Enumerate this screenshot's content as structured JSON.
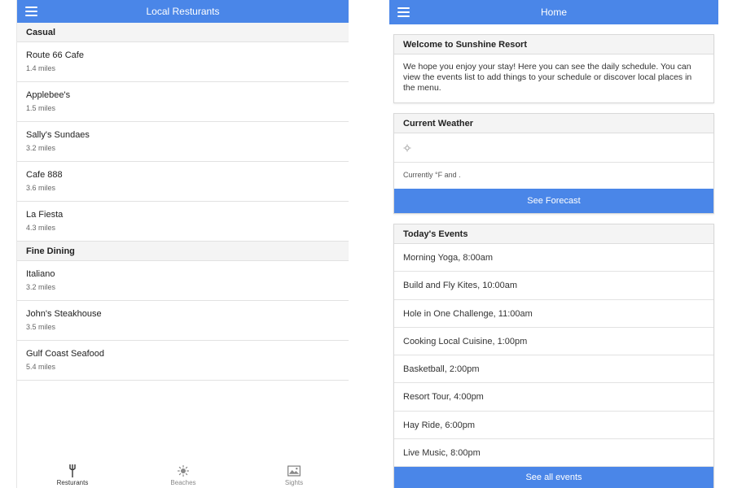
{
  "restaurants_screen": {
    "title": "Local Resturants",
    "sections": [
      {
        "label": "Casual",
        "items": [
          {
            "name": "Route 66 Cafe",
            "distance": "1.4 miles"
          },
          {
            "name": "Applebee's",
            "distance": "1.5 miles"
          },
          {
            "name": "Sally's Sundaes",
            "distance": "3.2 miles"
          },
          {
            "name": "Cafe 888",
            "distance": "3.6 miles"
          },
          {
            "name": "La Fiesta",
            "distance": "4.3 miles"
          }
        ]
      },
      {
        "label": "Fine Dining",
        "items": [
          {
            "name": "Italiano",
            "distance": "3.2 miles"
          },
          {
            "name": "John's Steakhouse",
            "distance": "3.5 miles"
          },
          {
            "name": "Gulf Coast Seafood",
            "distance": "5.4 miles"
          }
        ]
      }
    ],
    "tabs": [
      {
        "label": "Resturants",
        "icon": "fork-icon",
        "active": true
      },
      {
        "label": "Beaches",
        "icon": "sun-icon",
        "active": false
      },
      {
        "label": "Sights",
        "icon": "image-icon",
        "active": false
      }
    ]
  },
  "home_screen": {
    "title": "Home",
    "welcome": {
      "heading": "Welcome to Sunshine Resort",
      "body": "We hope you enjoy your stay! Here you can see the daily schedule. You can view the events list to add things to your schedule or discover local places in the menu."
    },
    "weather": {
      "heading": "Current Weather",
      "icon": "weather-placeholder-icon",
      "text": "Currently °F and .",
      "button_label": "See Forecast"
    },
    "events": {
      "heading": "Today's Events",
      "items": [
        "Morning Yoga, 8:00am",
        "Build and Fly Kites, 10:00am",
        "Hole in One Challenge, 11:00am",
        "Cooking Local Cuisine, 1:00pm",
        "Basketball, 2:00pm",
        "Resort Tour, 4:00pm",
        "Hay Ride, 6:00pm",
        "Live Music, 8:00pm"
      ],
      "button_label": "See all events"
    }
  },
  "colors": {
    "accent": "#4a86e8",
    "section_bg": "#f4f4f4",
    "divider": "#e2e2e2"
  }
}
